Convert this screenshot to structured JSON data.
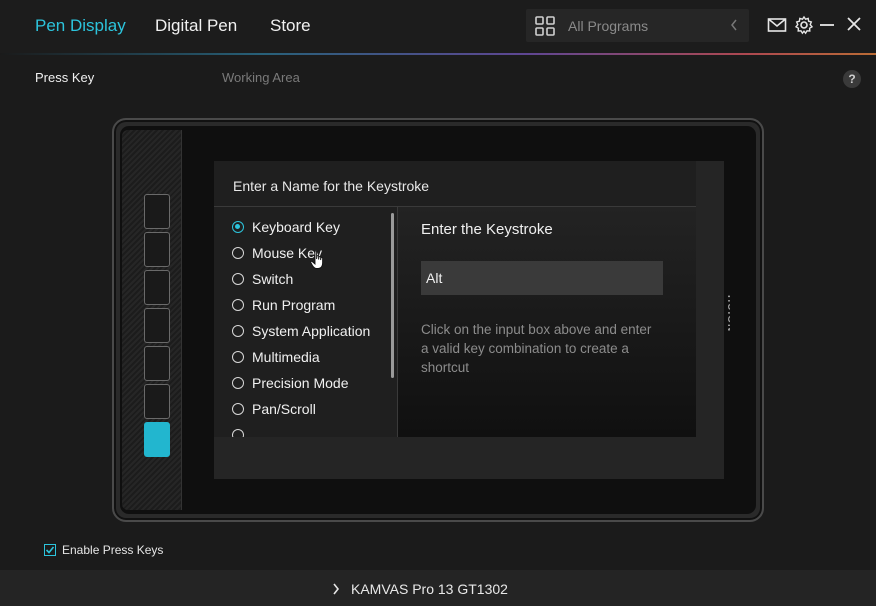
{
  "top_nav": {
    "tabs": [
      {
        "label": "Pen Display",
        "active": true
      },
      {
        "label": "Digital Pen",
        "active": false
      },
      {
        "label": "Store",
        "active": false
      }
    ],
    "program_selector": {
      "placeholder": "All Programs",
      "icon": "grid-icon"
    },
    "icons": [
      "mail-icon",
      "gear-icon",
      "minimize-icon",
      "close-icon"
    ]
  },
  "subtabs": {
    "press_key": "Press Key",
    "working_area": "Working Area",
    "help": "?"
  },
  "device": {
    "brand": "HUION",
    "keys_count": 7,
    "active_key": 7
  },
  "dialog": {
    "title": "Enter a Name for the Keystroke",
    "options": [
      {
        "label": "Keyboard Key",
        "checked": true
      },
      {
        "label": "Mouse Key",
        "checked": false
      },
      {
        "label": "Switch",
        "checked": false
      },
      {
        "label": "Run Program",
        "checked": false
      },
      {
        "label": "System Application",
        "checked": false
      },
      {
        "label": "Multimedia",
        "checked": false
      },
      {
        "label": "Precision Mode",
        "checked": false
      },
      {
        "label": "Pan/Scroll",
        "checked": false
      }
    ],
    "right": {
      "title": "Enter the Keystroke",
      "input_value": "Alt",
      "hint": "Click on the input box above and enter a valid key combination to create a shortcut"
    }
  },
  "enable_press_keys": {
    "label": "Enable Press Keys",
    "checked": true
  },
  "footer": {
    "device_name": "KAMVAS Pro 13 GT1302"
  },
  "colors": {
    "accent": "#2cc4dc",
    "background": "#1b1b1b"
  }
}
